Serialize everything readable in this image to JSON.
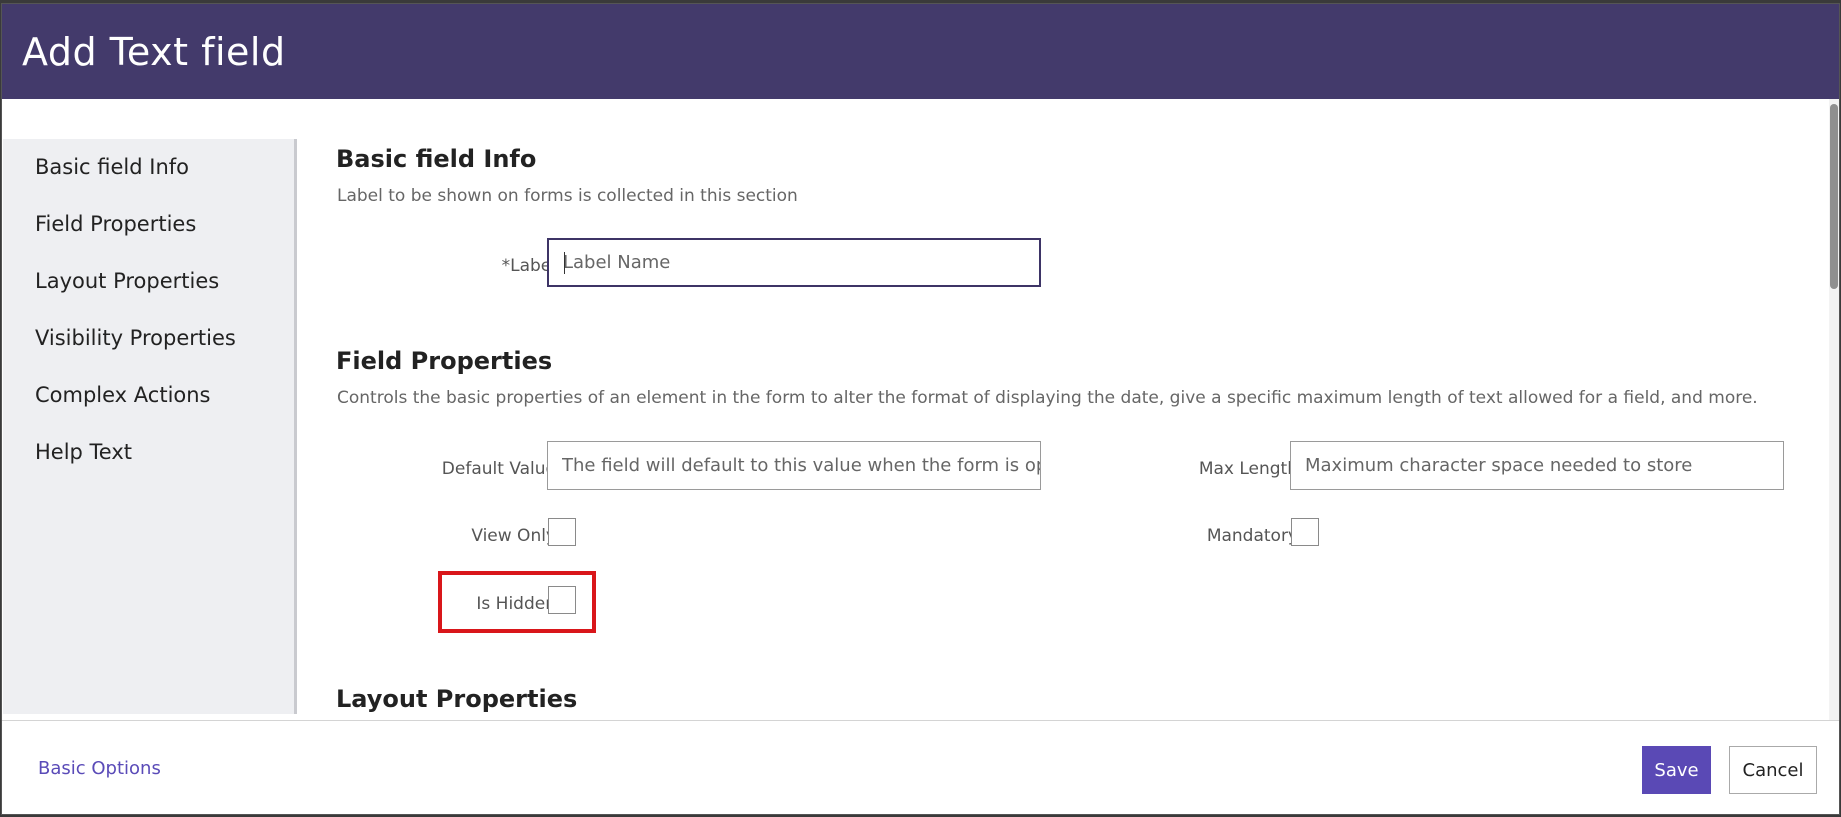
{
  "modal": {
    "title": "Add Text field"
  },
  "sidebar": {
    "items": [
      {
        "label": "Basic field Info"
      },
      {
        "label": "Field Properties"
      },
      {
        "label": "Layout Properties"
      },
      {
        "label": "Visibility Properties"
      },
      {
        "label": "Complex Actions"
      },
      {
        "label": "Help Text"
      }
    ]
  },
  "basic_info": {
    "title": "Basic field Info",
    "description": "Label to be shown on forms is collected in this section",
    "label_field": {
      "label": "*Label",
      "placeholder": "Label Name",
      "value": ""
    }
  },
  "field_properties": {
    "title": "Field Properties",
    "description": "Controls the basic properties of an element in the form to alter the format of displaying the date, give a specific maximum length of text allowed for a field, and more.",
    "default_value": {
      "label": "Default Value",
      "placeholder": "The field will default to this value when the form is open"
    },
    "max_length": {
      "label": "Max Length",
      "placeholder": "Maximum character space needed to store"
    },
    "view_only": {
      "label": "View Only",
      "checked": false
    },
    "mandatory": {
      "label": "Mandatory",
      "checked": false
    },
    "is_hidden": {
      "label": "Is Hidden",
      "checked": false
    }
  },
  "layout_properties": {
    "title": "Layout Properties"
  },
  "footer": {
    "basic_options_label": "Basic Options",
    "save_label": "Save",
    "cancel_label": "Cancel"
  },
  "colors": {
    "header_bg": "#433a6b",
    "primary_button": "#5a49b5",
    "link": "#5a4bb8",
    "highlight": "#d9161a"
  }
}
